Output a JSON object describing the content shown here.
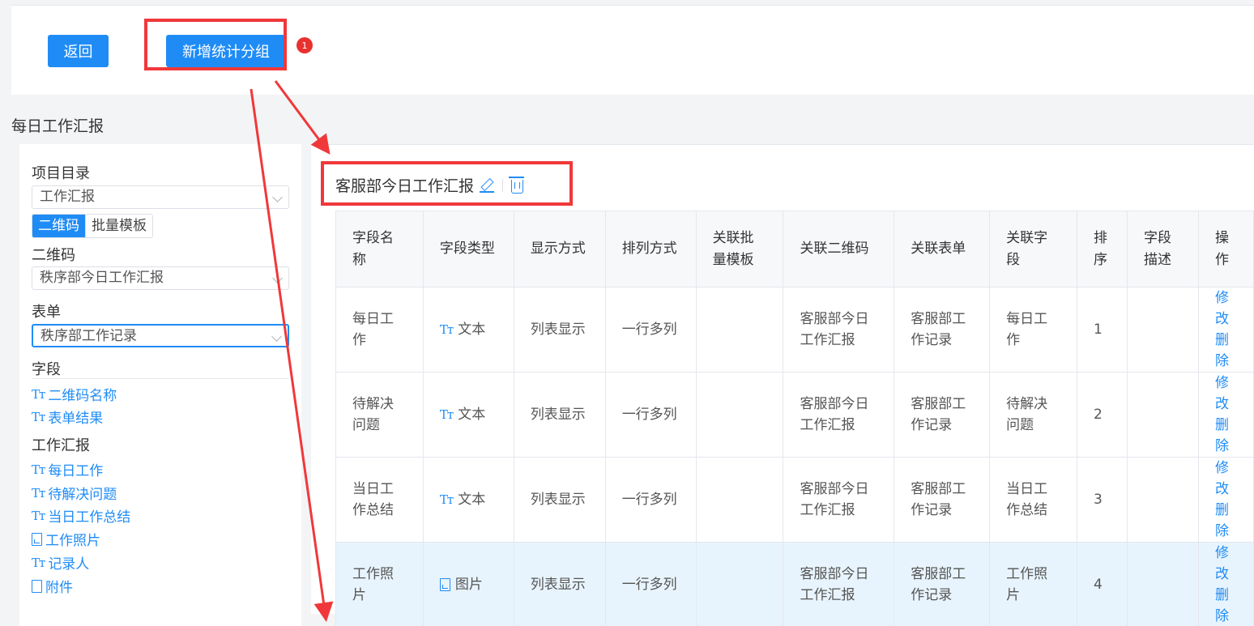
{
  "toolbar": {
    "back_label": "返回",
    "add_group_label": "新增统计分组",
    "badge": "1"
  },
  "page_title": "每日工作汇报",
  "sidebar": {
    "project_label": "项目目录",
    "project_value": "工作汇报",
    "tabs": [
      "二维码",
      "批量模板"
    ],
    "qrcode_label": "二维码",
    "qrcode_value": "秩序部今日工作汇报",
    "form_label": "表单",
    "form_value": "秩序部工作记录",
    "fields_label": "字段",
    "base_fields": [
      {
        "icon": "text-icon",
        "label": "二维码名称"
      },
      {
        "icon": "text-icon",
        "label": "表单结果"
      }
    ],
    "group_label": "工作汇报",
    "group_fields": [
      {
        "icon": "text-icon",
        "label": "每日工作"
      },
      {
        "icon": "text-icon",
        "label": "待解决问题"
      },
      {
        "icon": "text-icon",
        "label": "当日工作总结"
      },
      {
        "icon": "image-file-icon",
        "label": "工作照片"
      },
      {
        "icon": "text-icon",
        "label": "记录人"
      },
      {
        "icon": "file-icon",
        "label": "附件"
      }
    ]
  },
  "group": {
    "title": "客服部今日工作汇报"
  },
  "table": {
    "headers": [
      "字段名称",
      "字段类型",
      "显示方式",
      "排列方式",
      "关联批量模板",
      "关联二维码",
      "关联表单",
      "关联字段",
      "排序",
      "字段描述",
      "操作"
    ],
    "rows": [
      {
        "name": "每日工作",
        "type": "文本",
        "type_icon": "text-icon",
        "display": "列表显示",
        "layout": "一行多列",
        "batch": "",
        "qrcode": "客服部今日工作汇报",
        "form": "客服部工作记录",
        "field": "每日工作",
        "order": "1",
        "desc": "",
        "edit": "修改",
        "delete": "删除"
      },
      {
        "name": "待解决问题",
        "type": "文本",
        "type_icon": "text-icon",
        "display": "列表显示",
        "layout": "一行多列",
        "batch": "",
        "qrcode": "客服部今日工作汇报",
        "form": "客服部工作记录",
        "field": "待解决问题",
        "order": "2",
        "desc": "",
        "edit": "修改",
        "delete": "删除"
      },
      {
        "name": "当日工作总结",
        "type": "文本",
        "type_icon": "text-icon",
        "display": "列表显示",
        "layout": "一行多列",
        "batch": "",
        "qrcode": "客服部今日工作汇报",
        "form": "客服部工作记录",
        "field": "当日工作总结",
        "order": "3",
        "desc": "",
        "edit": "修改",
        "delete": "删除"
      },
      {
        "name": "工作照片",
        "type": "图片",
        "type_icon": "image-file-icon",
        "display": "列表显示",
        "layout": "一行多列",
        "batch": "",
        "qrcode": "客服部今日工作汇报",
        "form": "客服部工作记录",
        "field": "工作照片",
        "order": "4",
        "desc": "",
        "edit": "修改",
        "delete": "删除"
      }
    ]
  },
  "colors": {
    "primary": "#1f8cf6",
    "annotation": "#f0383a",
    "highlight_row": "#e8f4fd"
  }
}
